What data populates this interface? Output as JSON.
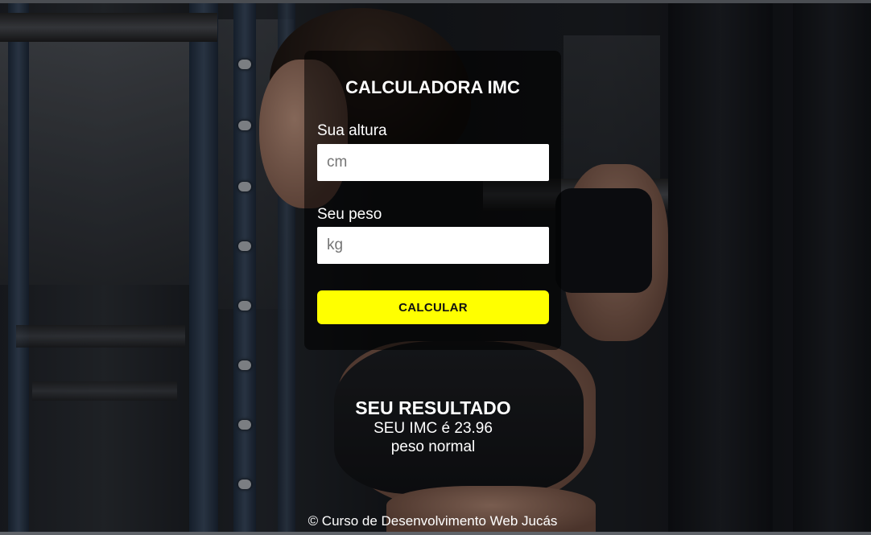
{
  "card": {
    "title": "CALCULADORA IMC",
    "height_label": "Sua altura",
    "height_placeholder": "cm",
    "height_value": "",
    "weight_label": "Seu peso",
    "weight_placeholder": "kg",
    "weight_value": "",
    "button_label": "CALCULAR"
  },
  "result": {
    "title": "SEU RESULTADO",
    "imc_text": "SEU IMC é 23.96",
    "classification": "peso normal"
  },
  "footer": {
    "text": "© Curso de Desenvolvimento Web Jucás"
  },
  "colors": {
    "accent_button": "#ffff00",
    "card_overlay": "rgba(0,0,0,0.55)"
  },
  "background": {
    "icon": "gym-woman-photo"
  }
}
